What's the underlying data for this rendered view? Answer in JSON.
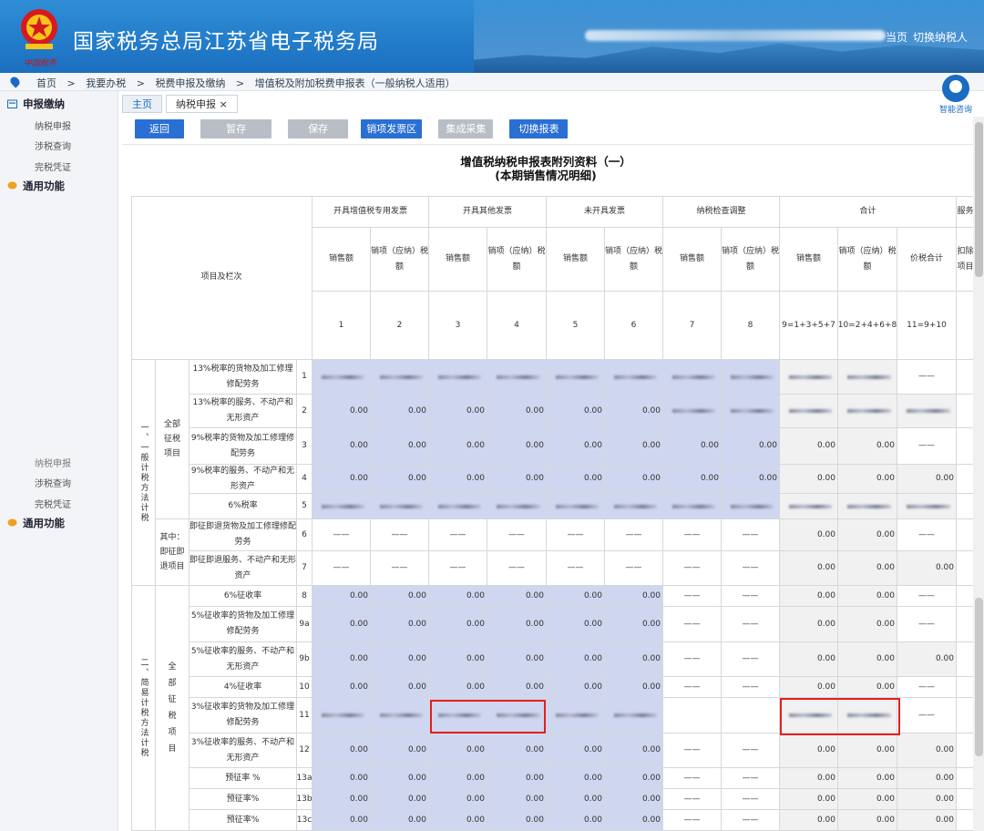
{
  "header": {
    "seal_text": "中国税务",
    "site_title": "国家税务总局江苏省电子税务局",
    "links": [
      "当页",
      "切换纳税人"
    ]
  },
  "breadcrumb": [
    "首页",
    ">",
    "我要办税",
    ">",
    "税费申报及缴纳",
    ">",
    "增值税及附加税费申报表（一般纳税人适用）"
  ],
  "help_label": "智能咨询",
  "sidebar": {
    "groups": [
      {
        "label": "申报缴纳",
        "items": [
          "纳税申报",
          "涉税查询",
          "完税凭证"
        ]
      },
      {
        "label": "通用功能",
        "items": []
      }
    ],
    "ghost_items": [
      "纳税申报",
      "涉税查询",
      "完税凭证"
    ],
    "ghost_group": "通用功能"
  },
  "tabs": [
    "主页",
    "纳税申报 ×"
  ],
  "toolbar": {
    "back": "返回",
    "temp_save": "暂存",
    "save": "保存",
    "invoice_area": "销项发票区",
    "collect": "集成采集",
    "switch": "切换报表"
  },
  "form": {
    "title": "增值税纳税申报表附列资料（一）",
    "subtitle": "(本期销售情况明细)",
    "header_groups": [
      "开具增值税专用发票",
      "开具其他发票",
      "未开具发票",
      "纳税检查调整",
      "合计",
      "服务"
    ],
    "sub_headers": [
      "销售额",
      "销项（应纳）税额",
      "销售额",
      "销项（应纳）税额",
      "销售额",
      "销项（应纳）税额",
      "销售额",
      "销项（应纳）税额",
      "销售额",
      "销项（应纳）税额",
      "价税合计",
      "扣除项目"
    ],
    "col_numbers": [
      "1",
      "2",
      "3",
      "4",
      "5",
      "6",
      "7",
      "8",
      "9=1+3+5+7",
      "10=2+4+6+8",
      "11=9+10"
    ],
    "item_header": "项目及栏次",
    "section1": "一、一般计税方法计税",
    "section2": "二、简易计税方法计税",
    "group_all": "全部征税项目",
    "group_refund": "其中：即征即退项目",
    "rows": [
      {
        "label": "13%税率的货物及加工修理修配劳务",
        "no": "1"
      },
      {
        "label": "13%税率的服务、不动产和无形资产",
        "no": "2"
      },
      {
        "label": "9%税率的货物及加工修理修配劳务",
        "no": "3"
      },
      {
        "label": "9%税率的服务、不动产和无形资产",
        "no": "4"
      },
      {
        "label": "6%税率",
        "no": "5"
      },
      {
        "label": "即征即退货物及加工修理修配劳务",
        "no": "6"
      },
      {
        "label": "即征即退服务、不动产和无形资产",
        "no": "7"
      },
      {
        "label": "6%征收率",
        "no": "8"
      },
      {
        "label": "5%征收率的货物及加工修理修配劳务",
        "no": "9a"
      },
      {
        "label": "5%征收率的服务、不动产和无形资产",
        "no": "9b"
      },
      {
        "label": "4%征收率",
        "no": "10"
      },
      {
        "label": "3%征收率的货物及加工修理修配劳务",
        "no": "11"
      },
      {
        "label": "3%征收率的服务、不动产和无形资产",
        "no": "12"
      },
      {
        "label": "预征率 %",
        "no": "13a"
      },
      {
        "label": "预征率%",
        "no": "13b"
      },
      {
        "label": "预征率%",
        "no": "13c"
      }
    ],
    "zero": "0.00",
    "dash": "——"
  },
  "colors": {
    "header_blue": "#1b6fc0",
    "button_blue": "#2a6fd3",
    "button_gray": "#b9bec6",
    "input_cell": "#cfd6ef",
    "readonly_cell": "#f1f1f1",
    "highlight": "#e02020"
  }
}
